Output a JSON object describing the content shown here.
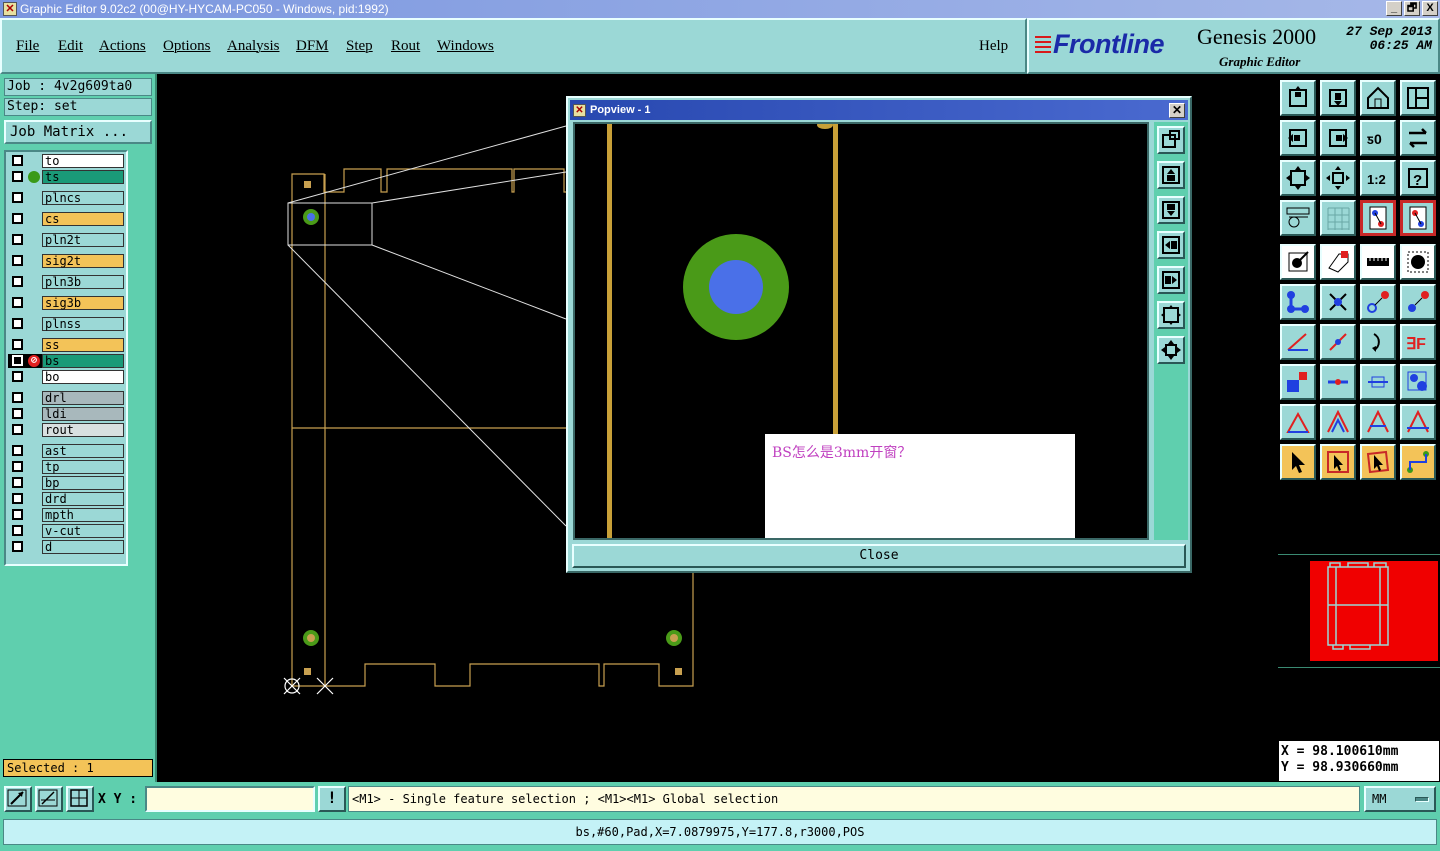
{
  "window": {
    "title": "Graphic Editor 9.02c2 (00@HY-HYCAM-PC050 - Windows, pid:1992)",
    "buttons": [
      "_",
      "🗗",
      "X"
    ]
  },
  "menu": {
    "items": [
      "File",
      "Edit",
      "Actions",
      "Options",
      "Analysis",
      "DFM",
      "Step",
      "Rout",
      "Windows"
    ],
    "help": "Help"
  },
  "brand": {
    "logo": "Frontline",
    "product": "Genesis 2000",
    "subtitle": "Graphic Editor",
    "date": "27 Sep 2013",
    "time": "06:25 AM"
  },
  "job": {
    "job_line": "Job : 4v2g609ta0",
    "step_line": "Step: set",
    "matrix_button": "Job Matrix ..."
  },
  "layers": [
    {
      "name": "to",
      "color": "#ffffff"
    },
    {
      "name": "ts",
      "color": "#1a9a78",
      "affected": true
    },
    {
      "name": "plncs",
      "color": "#9bd8d6"
    },
    {
      "name": "cs",
      "color": "#f3c358"
    },
    {
      "name": "pln2t",
      "color": "#9bd8d6"
    },
    {
      "name": "sig2t",
      "color": "#f3c358"
    },
    {
      "name": "pln3b",
      "color": "#9bd8d6"
    },
    {
      "name": "sig3b",
      "color": "#f3c358"
    },
    {
      "name": "plnss",
      "color": "#9bd8d6"
    },
    {
      "name": "ss",
      "color": "#f3c358"
    },
    {
      "name": "bs",
      "color": "#1a9a78",
      "work": true
    },
    {
      "name": "bo",
      "color": "#ffffff"
    },
    {
      "name": "drl",
      "color": "#a8b8bc"
    },
    {
      "name": "ldi",
      "color": "#a8b8bc"
    },
    {
      "name": "rout",
      "color": "#d8e0e0"
    },
    {
      "name": "ast",
      "color": "#9bd8d6"
    },
    {
      "name": "tp",
      "color": "#9bd8d6"
    },
    {
      "name": "bp",
      "color": "#9bd8d6"
    },
    {
      "name": "drd",
      "color": "#9bd8d6"
    },
    {
      "name": "mpth",
      "color": "#9bd8d6"
    },
    {
      "name": "v-cut",
      "color": "#9bd8d6"
    },
    {
      "name": "d",
      "color": "#9bd8d6"
    }
  ],
  "selected": "Selected : 1",
  "popview": {
    "title": "Popview - 1",
    "close_label": "Close",
    "note": "BS怎么是3mm开窗？"
  },
  "coords": {
    "x": "X  =  98.100610mm",
    "y": "Y  =  98.930660mm"
  },
  "status": {
    "xy_label": "X Y :",
    "xy_value": "",
    "warn": "!",
    "message": "<M1> - Single feature selection ; <M1><M1> Global selection",
    "units": "MM"
  },
  "info_line": "bs,#60,Pad,X=7.0879975,Y=177.8,r3000,POS"
}
